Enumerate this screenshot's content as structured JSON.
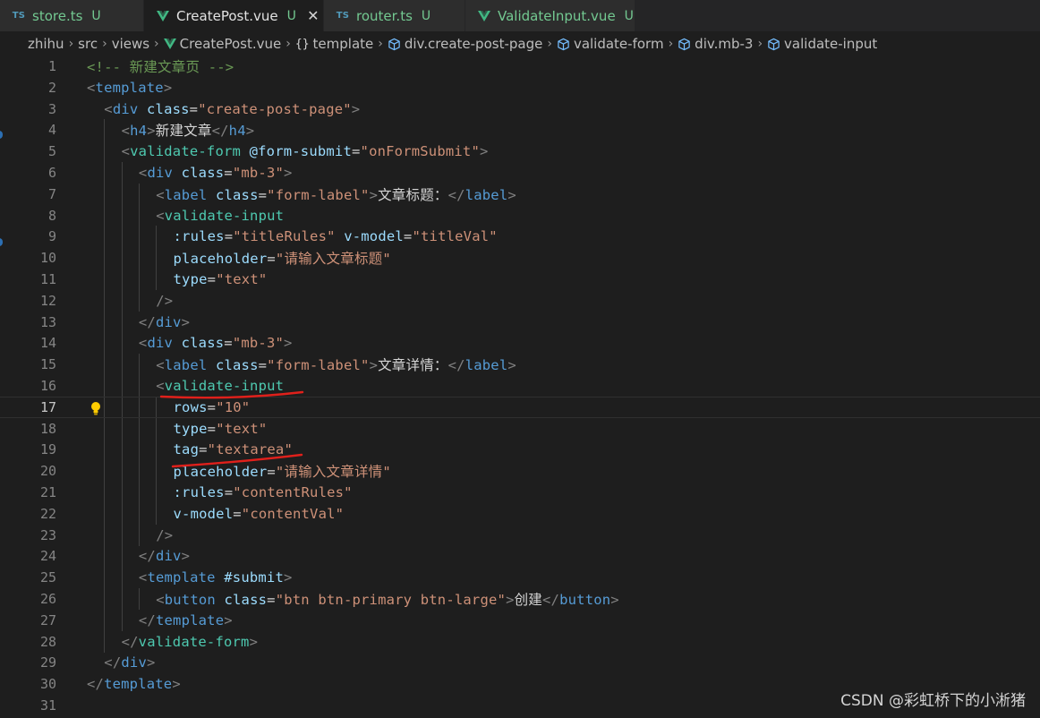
{
  "tabs": [
    {
      "icon": "typescript-file-icon",
      "icon_text": "TS",
      "label": "store.ts",
      "status": "U",
      "active": false
    },
    {
      "icon": "vue-file-icon",
      "icon_text": "",
      "label": "CreatePost.vue",
      "status": "U",
      "active": true,
      "close": "✕"
    },
    {
      "icon": "typescript-file-icon",
      "icon_text": "TS",
      "label": "router.ts",
      "status": "U",
      "active": false
    },
    {
      "icon": "vue-file-icon",
      "icon_text": "",
      "label": "ValidateInput.vue",
      "status": "U",
      "active": false
    }
  ],
  "breadcrumb": {
    "items": [
      {
        "label": "zhihu",
        "icon": ""
      },
      {
        "label": "src",
        "icon": ""
      },
      {
        "label": "views",
        "icon": ""
      },
      {
        "label": "CreatePost.vue",
        "icon": "vue-file-icon"
      },
      {
        "label": "template",
        "icon": "braces-icon",
        "icon_text": "{}"
      },
      {
        "label": "div.create-post-page",
        "icon": "cube-icon"
      },
      {
        "label": "validate-form",
        "icon": "cube-icon"
      },
      {
        "label": "div.mb-3",
        "icon": "cube-icon"
      },
      {
        "label": "validate-input",
        "icon": "cube-icon"
      }
    ],
    "separator": "›"
  },
  "editor": {
    "current_line": 17,
    "lightbulb_line": 17,
    "lines": [
      {
        "n": "1",
        "indent": 0,
        "tokens": [
          [
            "c-comment",
            "<!-- 新建文章页 -->"
          ]
        ]
      },
      {
        "n": "2",
        "indent": 0,
        "tokens": [
          [
            "c-punct",
            "<"
          ],
          [
            "c-tag",
            "template"
          ],
          [
            "c-punct",
            ">"
          ]
        ]
      },
      {
        "n": "3",
        "indent": 1,
        "tokens": [
          [
            "c-punct",
            "<"
          ],
          [
            "c-tag",
            "div"
          ],
          [
            "c-text",
            " "
          ],
          [
            "c-attr",
            "class"
          ],
          [
            "c-text",
            "="
          ],
          [
            "c-str",
            "\"create-post-page\""
          ],
          [
            "c-punct",
            ">"
          ]
        ]
      },
      {
        "n": "4",
        "indent": 2,
        "tokens": [
          [
            "c-punct",
            "<"
          ],
          [
            "c-tag",
            "h4"
          ],
          [
            "c-punct",
            ">"
          ],
          [
            "c-text",
            "新建文章"
          ],
          [
            "c-punct",
            "</"
          ],
          [
            "c-tag",
            "h4"
          ],
          [
            "c-punct",
            ">"
          ]
        ]
      },
      {
        "n": "5",
        "indent": 2,
        "tokens": [
          [
            "c-punct",
            "<"
          ],
          [
            "c-comp",
            "validate-form"
          ],
          [
            "c-text",
            " "
          ],
          [
            "c-attr",
            "@form-submit"
          ],
          [
            "c-text",
            "="
          ],
          [
            "c-str",
            "\"onFormSubmit\""
          ],
          [
            "c-punct",
            ">"
          ]
        ]
      },
      {
        "n": "6",
        "indent": 3,
        "tokens": [
          [
            "c-punct",
            "<"
          ],
          [
            "c-tag",
            "div"
          ],
          [
            "c-text",
            " "
          ],
          [
            "c-attr",
            "class"
          ],
          [
            "c-text",
            "="
          ],
          [
            "c-str",
            "\"mb-3\""
          ],
          [
            "c-punct",
            ">"
          ]
        ]
      },
      {
        "n": "7",
        "indent": 4,
        "tokens": [
          [
            "c-punct",
            "<"
          ],
          [
            "c-tag",
            "label"
          ],
          [
            "c-text",
            " "
          ],
          [
            "c-attr",
            "class"
          ],
          [
            "c-text",
            "="
          ],
          [
            "c-str",
            "\"form-label\""
          ],
          [
            "c-punct",
            ">"
          ],
          [
            "c-text",
            "文章标题："
          ],
          [
            "c-punct",
            "</"
          ],
          [
            "c-tag",
            "label"
          ],
          [
            "c-punct",
            ">"
          ]
        ]
      },
      {
        "n": "8",
        "indent": 4,
        "tokens": [
          [
            "c-punct",
            "<"
          ],
          [
            "c-comp",
            "validate-input"
          ]
        ]
      },
      {
        "n": "9",
        "indent": 5,
        "tokens": [
          [
            "c-attr",
            ":rules"
          ],
          [
            "c-text",
            "="
          ],
          [
            "c-str",
            "\"titleRules\""
          ],
          [
            "c-text",
            " "
          ],
          [
            "c-attr",
            "v-model"
          ],
          [
            "c-text",
            "="
          ],
          [
            "c-str",
            "\"titleVal\""
          ]
        ]
      },
      {
        "n": "10",
        "indent": 5,
        "tokens": [
          [
            "c-attr",
            "placeholder"
          ],
          [
            "c-text",
            "="
          ],
          [
            "c-str",
            "\"请输入文章标题\""
          ]
        ]
      },
      {
        "n": "11",
        "indent": 5,
        "tokens": [
          [
            "c-attr",
            "type"
          ],
          [
            "c-text",
            "="
          ],
          [
            "c-str",
            "\"text\""
          ]
        ]
      },
      {
        "n": "12",
        "indent": 4,
        "tokens": [
          [
            "c-punct",
            "/>"
          ]
        ]
      },
      {
        "n": "13",
        "indent": 3,
        "tokens": [
          [
            "c-punct",
            "</"
          ],
          [
            "c-tag",
            "div"
          ],
          [
            "c-punct",
            ">"
          ]
        ]
      },
      {
        "n": "14",
        "indent": 3,
        "tokens": [
          [
            "c-punct",
            "<"
          ],
          [
            "c-tag",
            "div"
          ],
          [
            "c-text",
            " "
          ],
          [
            "c-attr",
            "class"
          ],
          [
            "c-text",
            "="
          ],
          [
            "c-str",
            "\"mb-3\""
          ],
          [
            "c-punct",
            ">"
          ]
        ]
      },
      {
        "n": "15",
        "indent": 4,
        "tokens": [
          [
            "c-punct",
            "<"
          ],
          [
            "c-tag",
            "label"
          ],
          [
            "c-text",
            " "
          ],
          [
            "c-attr",
            "class"
          ],
          [
            "c-text",
            "="
          ],
          [
            "c-str",
            "\"form-label\""
          ],
          [
            "c-punct",
            ">"
          ],
          [
            "c-text",
            "文章详情："
          ],
          [
            "c-punct",
            "</"
          ],
          [
            "c-tag",
            "label"
          ],
          [
            "c-punct",
            ">"
          ]
        ]
      },
      {
        "n": "16",
        "indent": 4,
        "tokens": [
          [
            "c-punct",
            "<"
          ],
          [
            "c-comp",
            "validate-input"
          ]
        ]
      },
      {
        "n": "17",
        "indent": 5,
        "tokens": [
          [
            "c-attr",
            "rows"
          ],
          [
            "c-text",
            "="
          ],
          [
            "c-str",
            "\"10\""
          ]
        ]
      },
      {
        "n": "18",
        "indent": 5,
        "tokens": [
          [
            "c-attr",
            "type"
          ],
          [
            "c-text",
            "="
          ],
          [
            "c-str",
            "\"text\""
          ]
        ]
      },
      {
        "n": "19",
        "indent": 5,
        "tokens": [
          [
            "c-attr",
            "tag"
          ],
          [
            "c-text",
            "="
          ],
          [
            "c-str",
            "\"textarea\""
          ]
        ]
      },
      {
        "n": "20",
        "indent": 5,
        "tokens": [
          [
            "c-attr",
            "placeholder"
          ],
          [
            "c-text",
            "="
          ],
          [
            "c-str",
            "\"请输入文章详情\""
          ]
        ]
      },
      {
        "n": "21",
        "indent": 5,
        "tokens": [
          [
            "c-attr",
            ":rules"
          ],
          [
            "c-text",
            "="
          ],
          [
            "c-str",
            "\"contentRules\""
          ]
        ]
      },
      {
        "n": "22",
        "indent": 5,
        "tokens": [
          [
            "c-attr",
            "v-model"
          ],
          [
            "c-text",
            "="
          ],
          [
            "c-str",
            "\"contentVal\""
          ]
        ]
      },
      {
        "n": "23",
        "indent": 4,
        "tokens": [
          [
            "c-punct",
            "/>"
          ]
        ]
      },
      {
        "n": "24",
        "indent": 3,
        "tokens": [
          [
            "c-punct",
            "</"
          ],
          [
            "c-tag",
            "div"
          ],
          [
            "c-punct",
            ">"
          ]
        ]
      },
      {
        "n": "25",
        "indent": 3,
        "tokens": [
          [
            "c-punct",
            "<"
          ],
          [
            "c-tag",
            "template"
          ],
          [
            "c-text",
            " "
          ],
          [
            "c-attr",
            "#submit"
          ],
          [
            "c-punct",
            ">"
          ]
        ]
      },
      {
        "n": "26",
        "indent": 4,
        "tokens": [
          [
            "c-punct",
            "<"
          ],
          [
            "c-tag",
            "button"
          ],
          [
            "c-text",
            " "
          ],
          [
            "c-attr",
            "class"
          ],
          [
            "c-text",
            "="
          ],
          [
            "c-str",
            "\"btn btn-primary btn-large\""
          ],
          [
            "c-punct",
            ">"
          ],
          [
            "c-text",
            "创建"
          ],
          [
            "c-punct",
            "</"
          ],
          [
            "c-tag",
            "button"
          ],
          [
            "c-punct",
            ">"
          ]
        ]
      },
      {
        "n": "27",
        "indent": 3,
        "tokens": [
          [
            "c-punct",
            "</"
          ],
          [
            "c-tag",
            "template"
          ],
          [
            "c-punct",
            ">"
          ]
        ]
      },
      {
        "n": "28",
        "indent": 2,
        "tokens": [
          [
            "c-punct",
            "</"
          ],
          [
            "c-comp",
            "validate-form"
          ],
          [
            "c-punct",
            ">"
          ]
        ]
      },
      {
        "n": "29",
        "indent": 1,
        "tokens": [
          [
            "c-punct",
            "</"
          ],
          [
            "c-tag",
            "div"
          ],
          [
            "c-punct",
            ">"
          ]
        ]
      },
      {
        "n": "30",
        "indent": 0,
        "tokens": [
          [
            "c-punct",
            "</"
          ],
          [
            "c-tag",
            "template"
          ],
          [
            "c-punct",
            ">"
          ]
        ]
      },
      {
        "n": "31",
        "indent": 0,
        "tokens": []
      }
    ]
  },
  "colors": {
    "editor_bg": "#1e1e1e",
    "annotation_red": "#e0201b",
    "vue_green": "#41b883",
    "ts_blue": "#519aba",
    "bulb_yellow": "#ffcc00"
  },
  "watermark": "CSDN @彩虹桥下的小淅猪"
}
